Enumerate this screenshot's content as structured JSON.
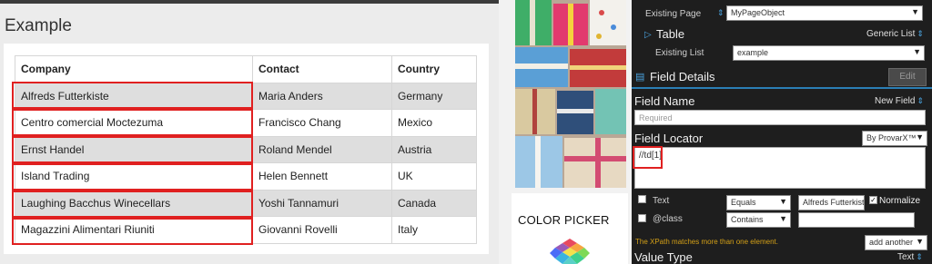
{
  "page": {
    "title": "Example",
    "table": {
      "headers": [
        "Company",
        "Contact",
        "Country"
      ],
      "rows": [
        {
          "company": "Alfreds Futterkiste",
          "contact": "Maria Anders",
          "country": "Germany"
        },
        {
          "company": "Centro comercial Moctezuma",
          "contact": "Francisco Chang",
          "country": "Mexico"
        },
        {
          "company": "Ernst Handel",
          "contact": "Roland Mendel",
          "country": "Austria"
        },
        {
          "company": "Island Trading",
          "contact": "Helen Bennett",
          "country": "UK"
        },
        {
          "company": "Laughing Bacchus Winecellars",
          "contact": "Yoshi Tannamuri",
          "country": "Canada"
        },
        {
          "company": "Magazzini Alimentari Riuniti",
          "contact": "Giovanni Rovelli",
          "country": "Italy"
        }
      ]
    }
  },
  "ad": {
    "color_picker_title": "COLOR PICKER"
  },
  "panel": {
    "existing_page_label": "Existing Page",
    "existing_page_value": "MyPageObject",
    "table_section": "Table",
    "generic_list": "Generic List",
    "existing_list_label": "Existing List",
    "existing_list_value": "example",
    "field_details_title": "Field Details",
    "edit_button": "Edit",
    "field_name_label": "Field Name",
    "new_field": "New Field",
    "field_name_placeholder": "Required",
    "field_locator_label": "Field Locator",
    "locator_type": "By ProvarX™",
    "locator_value": "//td[1]",
    "attr_text_label": "Text",
    "attr_class_label": "@class",
    "op_equals": "Equals",
    "op_contains": "Contains",
    "text_value": "Alfreds Futterkist",
    "normalize_label": "Normalize",
    "xpath_message": "The XPath matches more than one element.",
    "add_another": "add another",
    "value_type_label": "Value Type",
    "value_type_value": "Text"
  },
  "colors": {
    "highlight": "#e02020",
    "panel_bg": "#1e1e1e",
    "accent_blue": "#2b7fb5",
    "warning": "#d4a017"
  }
}
